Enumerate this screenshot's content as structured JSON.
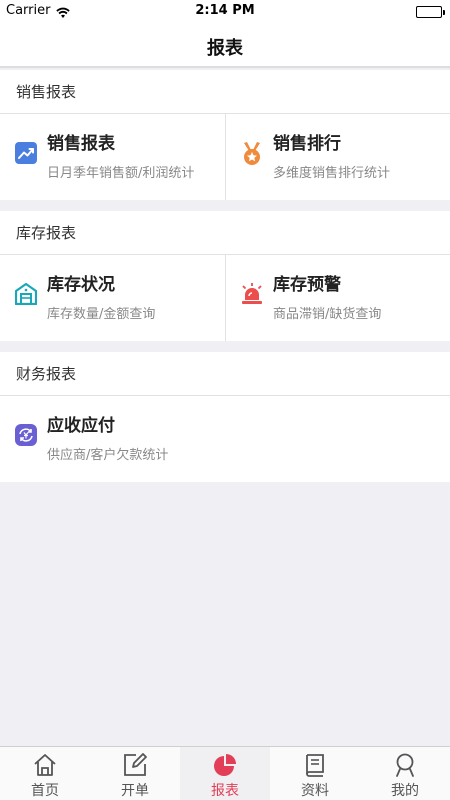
{
  "status_bar": {
    "carrier": "Carrier",
    "time": "2:14 PM"
  },
  "nav": {
    "title": "报表"
  },
  "sections": [
    {
      "header": "销售报表",
      "cards": [
        {
          "title": "销售报表",
          "subtitle": "日月季年销售额/利润统计",
          "icon": "trend-chart-icon",
          "color": "#4a7fe0"
        },
        {
          "title": "销售排行",
          "subtitle": "多维度销售排行统计",
          "icon": "medal-icon",
          "color": "#f08a3c"
        }
      ]
    },
    {
      "header": "库存报表",
      "cards": [
        {
          "title": "库存状况",
          "subtitle": "库存数量/金额查询",
          "icon": "warehouse-icon",
          "color": "#1aa8b8"
        },
        {
          "title": "库存预警",
          "subtitle": "商品滞销/缺货查询",
          "icon": "alarm-light-icon",
          "color": "#ec4d4d"
        }
      ]
    },
    {
      "header": "财务报表",
      "cards": [
        {
          "title": "应收应付",
          "subtitle": "供应商/客户欠款统计",
          "icon": "currency-exchange-icon",
          "color": "#6a5fd3"
        }
      ]
    }
  ],
  "tabs": [
    {
      "label": "首页",
      "icon": "home-icon"
    },
    {
      "label": "开单",
      "icon": "edit-icon"
    },
    {
      "label": "报表",
      "icon": "pie-chart-icon",
      "active": true
    },
    {
      "label": "资料",
      "icon": "book-icon"
    },
    {
      "label": "我的",
      "icon": "profile-icon"
    }
  ],
  "colors": {
    "accent": "#e23e57",
    "background": "#efeff4"
  }
}
